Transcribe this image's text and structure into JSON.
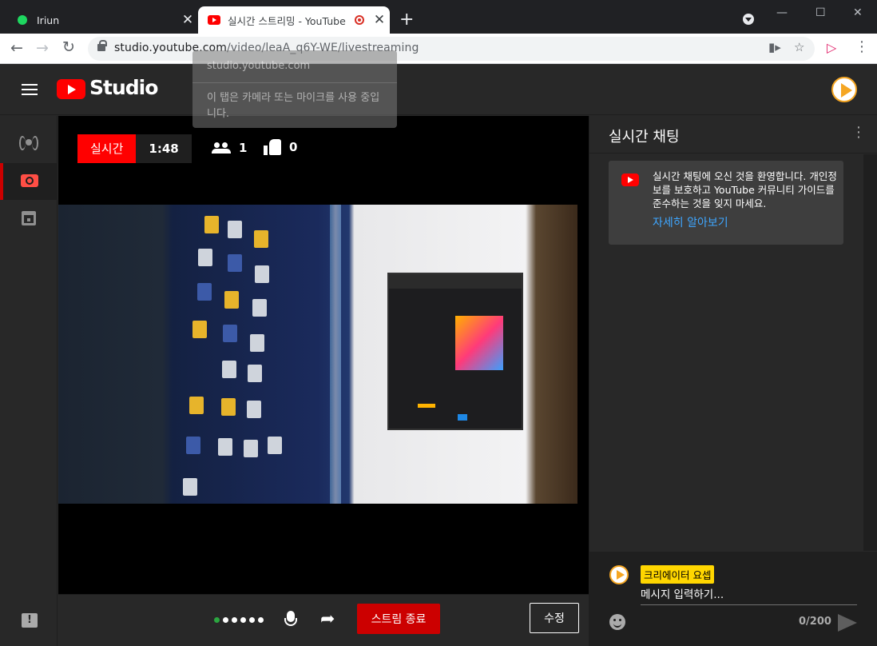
{
  "browser": {
    "tabs": [
      {
        "title": "Iriun",
        "close": "✕"
      },
      {
        "title": "실시간 스트리밍 - YouTube",
        "close": "✕"
      }
    ],
    "new_tab": "+",
    "url_host": "studio.youtube.com",
    "url_path": "/video/leaA_q6Y-WE/livestreaming",
    "window_controls": [
      "—",
      "☐",
      "✕"
    ],
    "popup": {
      "host": "studio.youtube.com",
      "message": "이 탭은 카메라 또는 마이크를 사용 중입니다."
    }
  },
  "studio": {
    "logo_text": "Studio",
    "status": {
      "live_label": "실시간",
      "duration": "1:48",
      "viewers": "1",
      "likes": "0"
    },
    "controls": {
      "end_stream": "스트림 종료",
      "edit": "수정"
    },
    "chat": {
      "title": "실시간 채팅",
      "welcome": "실시간 채팅에 오신 것을 환영합니다. 개인정보를 보호하고 YouTube 커뮤니티 가이드를 준수하는 것을 잊지 마세요.",
      "learn_more": "자세히 알아보기",
      "owner_badge": "크리에이터 요셉",
      "placeholder": "메시지 입력하기...",
      "char_count": "0/200"
    }
  },
  "colors": {
    "youtube_red": "#ff0000",
    "end_button": "#cc0000",
    "link_blue": "#3ea6ff",
    "badge_yellow": "#ffd600"
  }
}
